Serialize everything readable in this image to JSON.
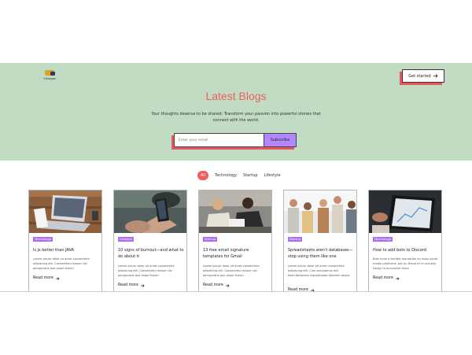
{
  "header": {
    "logo_text": "Y-blogger",
    "cta_label": "Get started",
    "cta_icon": "arrow-right-icon"
  },
  "hero": {
    "title": "Latest Blogs",
    "subtitle": "Your thoughts deserve to be shared. Transform your passion into powerful stories that connect with the world.",
    "email_placeholder": "Enter your email",
    "subscribe_label": "Subscribe"
  },
  "filters": [
    "All",
    "Technology",
    "Startup",
    "Lifestyle"
  ],
  "cards": [
    {
      "category": "Technology",
      "title": "Is js better than JAVA",
      "excerpt": "Lorem ipsum dolor sit amet consectetur adipiscing elit. Consectetur eaque nisi perspiciatis quo sequi libero!",
      "read_more": "Read more",
      "image": "laptop-desk"
    },
    {
      "category": "Lifestyle",
      "title": "10 signs of burnout—and what to do about it",
      "excerpt": "Lorem ipsum dolor sit amet consectetur adipiscing elit. Consectetur eaque nisi perspiciatis quo sequi libero!",
      "read_more": "Read more",
      "image": "phone-hands"
    },
    {
      "category": "Startup",
      "title": "13 free email signature templates for Gmail",
      "excerpt": "Lorem ipsum dolor sit amet consectetur adipiscing elit. Consectetur eaque nisi perspiciatis quo sequi libero!",
      "read_more": "Read more",
      "image": "meeting"
    },
    {
      "category": "Startup",
      "title": "Spreadsheets aren't databases—stop using them like one",
      "excerpt": "Lorem ipsum dolor sit amet consectetur adipiscing elit. Cum accusamus est, exercitationem repudiandae dolorem atque.",
      "read_more": "Read more",
      "image": "friends-group"
    },
    {
      "category": "Technology",
      "title": "How to add bots to Discord",
      "excerpt": "Bots have a terrible reputation on most social media platforms, but on Discord I'm actually happy to encounter them.",
      "read_more": "Read more",
      "image": "tablet"
    }
  ],
  "colors": {
    "hero_bg": "#c2dcc4",
    "accent": "#ef5d5d",
    "subscribe": "#b388ff",
    "badge": "#b06cf0"
  }
}
